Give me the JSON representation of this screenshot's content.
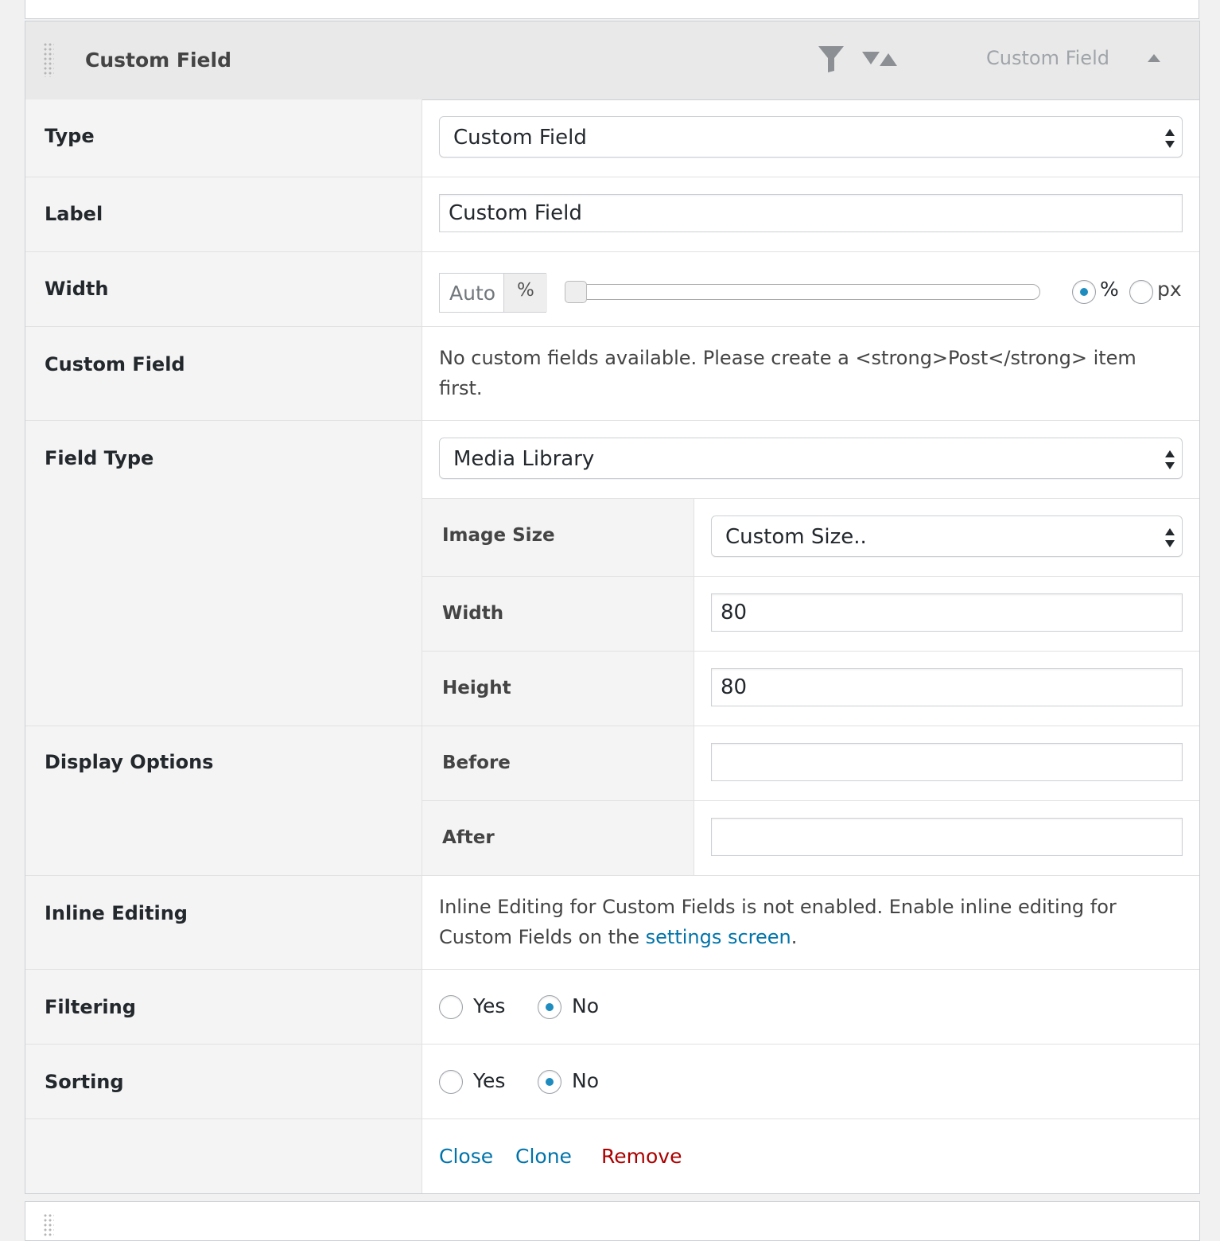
{
  "header": {
    "title": "Custom Field",
    "type_label": "Custom Field",
    "icons": [
      "filter-icon",
      "sort-icon",
      "toggle-up-icon",
      "drag-handle-icon"
    ]
  },
  "rows": {
    "type": {
      "label": "Type",
      "value": "Custom Field"
    },
    "label": {
      "label": "Label",
      "value": "Custom Field"
    },
    "width": {
      "label": "Width",
      "input_value": "Auto",
      "unit": "%",
      "slider_level": 0,
      "radio_percent": "%",
      "radio_px": "px",
      "selected": "%"
    },
    "custom_field": {
      "label": "Custom Field",
      "message": "No custom fields available. Please create a <strong>Post</strong> item first."
    },
    "field_type": {
      "label": "Field Type",
      "value": "Media Library",
      "image_size": {
        "label": "Image Size",
        "value": "Custom Size.."
      },
      "width": {
        "label": "Width",
        "value": "80"
      },
      "height": {
        "label": "Height",
        "value": "80"
      }
    },
    "display_options": {
      "label": "Display Options",
      "before": {
        "label": "Before",
        "value": ""
      },
      "after": {
        "label": "After",
        "value": ""
      }
    },
    "inline_editing": {
      "label": "Inline Editing",
      "message_part1": "Inline Editing for Custom Fields is not enabled. Enable inline editing for Custom Fields on the ",
      "link_text": "settings screen",
      "message_part2": "."
    },
    "filtering": {
      "label": "Filtering",
      "yes": "Yes",
      "no": "No",
      "selected": "No"
    },
    "sorting": {
      "label": "Sorting",
      "yes": "Yes",
      "no": "No",
      "selected": "No"
    }
  },
  "actions": {
    "close": "Close",
    "clone": "Clone",
    "remove": "Remove"
  },
  "colors": {
    "link": "#0073aa",
    "remove": "#a00",
    "radio_selected": "#1e8cbe",
    "label_bg": "#f4f4f4",
    "header_bg": "#e9e9e9"
  }
}
